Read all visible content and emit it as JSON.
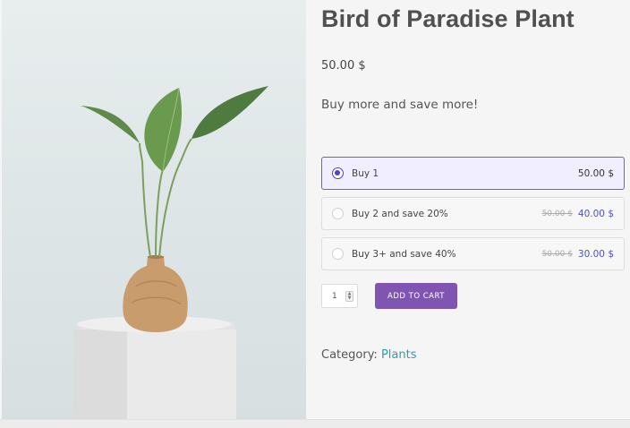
{
  "product": {
    "title": "Bird of Paradise Plant",
    "price": "50.00 $",
    "promo_text": "Buy more and save more!",
    "image_icon": "potted-plant-image"
  },
  "offers": [
    {
      "label": "Buy 1",
      "old_price": "",
      "price": "50.00 $",
      "selected": true
    },
    {
      "label": "Buy 2 and save 20%",
      "old_price": "50.00 $",
      "price": "40.00 $",
      "selected": false
    },
    {
      "label": "Buy 3+ and save 40%",
      "old_price": "50.00 $",
      "price": "30.00 $",
      "selected": false
    }
  ],
  "cart": {
    "quantity": "1",
    "add_to_cart_label": "ADD TO CART"
  },
  "category": {
    "label": "Category:",
    "link_text": "Plants"
  },
  "colors": {
    "accent_purple": "#7f55b1",
    "selected_border": "#6c5ed4",
    "discount_price": "#4d50c8",
    "category_link": "#2aa0b2"
  }
}
